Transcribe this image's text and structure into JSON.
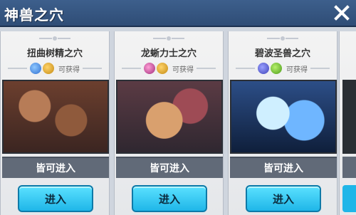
{
  "window": {
    "title": "神兽之穴"
  },
  "cards": [
    {
      "name": "扭曲树精之穴",
      "reward_label": "可获得",
      "status": "皆可进入",
      "enter_label": "进入"
    },
    {
      "name": "龙蜥力士之穴",
      "reward_label": "可获得",
      "status": "皆可进入",
      "enter_label": "进入"
    },
    {
      "name": "碧波圣兽之穴",
      "reward_label": "可获得",
      "status": "皆可进入",
      "enter_label": "进入"
    }
  ],
  "colors": {
    "accent": "#1fb6e8",
    "title_bar": "#3d5f8c"
  }
}
